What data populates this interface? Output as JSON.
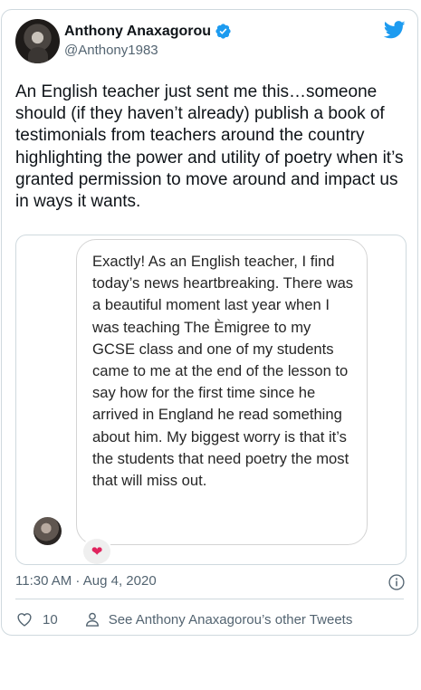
{
  "author": {
    "name": "Anthony Anaxagorou",
    "handle": "@Anthony1983",
    "verified": true
  },
  "tweet": {
    "text": "An English teacher just sent me this…someone should (if they haven’t already) publish a book of testimonials from teachers around the country highlighting the power and utility of poetry when it’s granted permission to move around and impact us in ways it wants."
  },
  "media": {
    "message_text": "Exactly! As an English teacher, I find today’s news heartbreaking. There was a beautiful moment last year when I was teaching The Èmigree to my GCSE class and one of my students came to me at the end of the lesson to say how for the first time since he arrived in England he read something about him. My biggest worry is that it’s the students that need poetry the most that will miss out.",
    "reaction": "❤"
  },
  "meta": {
    "timestamp": "11:30 AM · Aug 4, 2020"
  },
  "actions": {
    "like_count": "10",
    "other_tweets_label": "See Anthony Anaxagorou’s other Tweets"
  },
  "colors": {
    "twitter_blue": "#1d9bf0",
    "secondary_text": "#536471",
    "border": "#cfd9de",
    "heart": "#e0245e"
  },
  "icons": [
    "verified-badge-icon",
    "twitter-bird-icon",
    "info-icon",
    "heart-icon",
    "person-icon"
  ]
}
